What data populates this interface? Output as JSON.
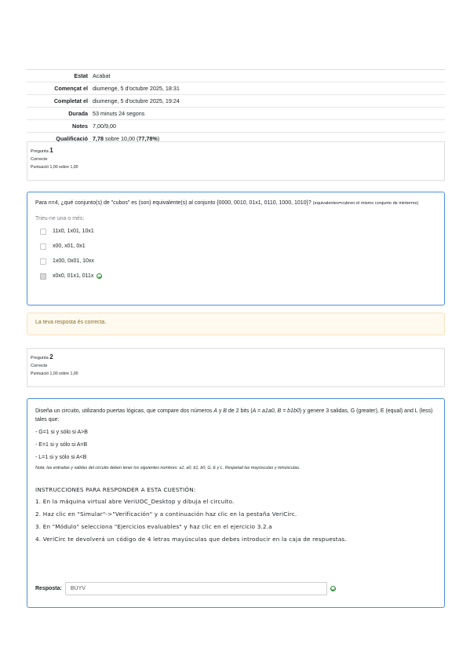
{
  "summary": {
    "rows": [
      {
        "key": "Estat",
        "value": "Acabat"
      },
      {
        "key": "Començat el",
        "value": "diumenge, 5 d'octubre 2025, 18:31"
      },
      {
        "key": "Completat el",
        "value": "diumenge, 5 d'octubre 2025, 19:24"
      },
      {
        "key": "Durada",
        "value": "53 minuts 24 segons"
      },
      {
        "key": "Notes",
        "value": "7,00/9,00"
      }
    ],
    "grade_key": "Qualificació",
    "grade_score": "7,78",
    "grade_mid": " sobre 10,00 (",
    "grade_pct": "77,78%",
    "grade_end": ")"
  },
  "q1": {
    "label": "Pregunta ",
    "number": "1",
    "state": "Correcte",
    "mark": "Puntuació 1,00 sobre 1,00",
    "text": "Para n=4, ¿qué conjunto(s) de \"cubos\" es (son) equivalente(s) al conjunto {0000, 0010, 01x1, 0110, 1000, 1010}? ",
    "text_small": "(equivalentes=cubren el mismo conjunto de minterms)",
    "prompt": "Trieu-ne una o més:",
    "options": [
      "11x0, 1x01, 10x1",
      "x00, x01, 0x1",
      "1x00, 0x01, 10xx",
      "x0x0, 01x1, 011x"
    ],
    "feedback": "La teva resposta és correcta."
  },
  "q2": {
    "label": "Pregunta ",
    "number": "2",
    "state": "Correcte",
    "mark": "Puntuació 1,00 sobre 1,00",
    "intro_a": "Diseña un circuito, utilizando puertas lógicas, que compare dos números ",
    "intro_A": "A",
    "intro_b": " y ",
    "intro_B": "B",
    "intro_c": " de 2 bits (",
    "intro_d": "A = a1a0, B = b1b0",
    "intro_e": ") y genere 3 salidas, G (greater), E (equal) and L (less) tales que:",
    "cond1": "- G=1 si y sólo si A>B",
    "cond2": "- E=1 si y sólo si A=B",
    "cond3": "- L=1 si y sólo si A<B",
    "note": "Nota: las entradas y salidas del circuito deben tener los siguientes nombres: a1, a0, b1, b0, G, E y L. Respetad las mayúsculas y minúsculas.",
    "instr_title": "INSTRUCCIONES PARA RESPONDER A ESTA CUESTIÓN:",
    "instr1": "1. En la máquina virtual abre VeriUOC_Desktop y dibuja el circuito.",
    "instr2": "2. Haz clic en \"Simular\"->\"Verificación\" y a continuación haz clic en la pestaña VeriCirc.",
    "instr3": "3. En \"Módulo\" selecciona \"Ejercicios evaluables\" y haz clic en el ejercicio 3.2.a",
    "instr4": "4. VeriCirc te devolverá un código de 4 letras mayúsculas que debes introducir en la caja de respuestas.",
    "answer_label": "Resposta:",
    "answer_value": "BUYV"
  }
}
